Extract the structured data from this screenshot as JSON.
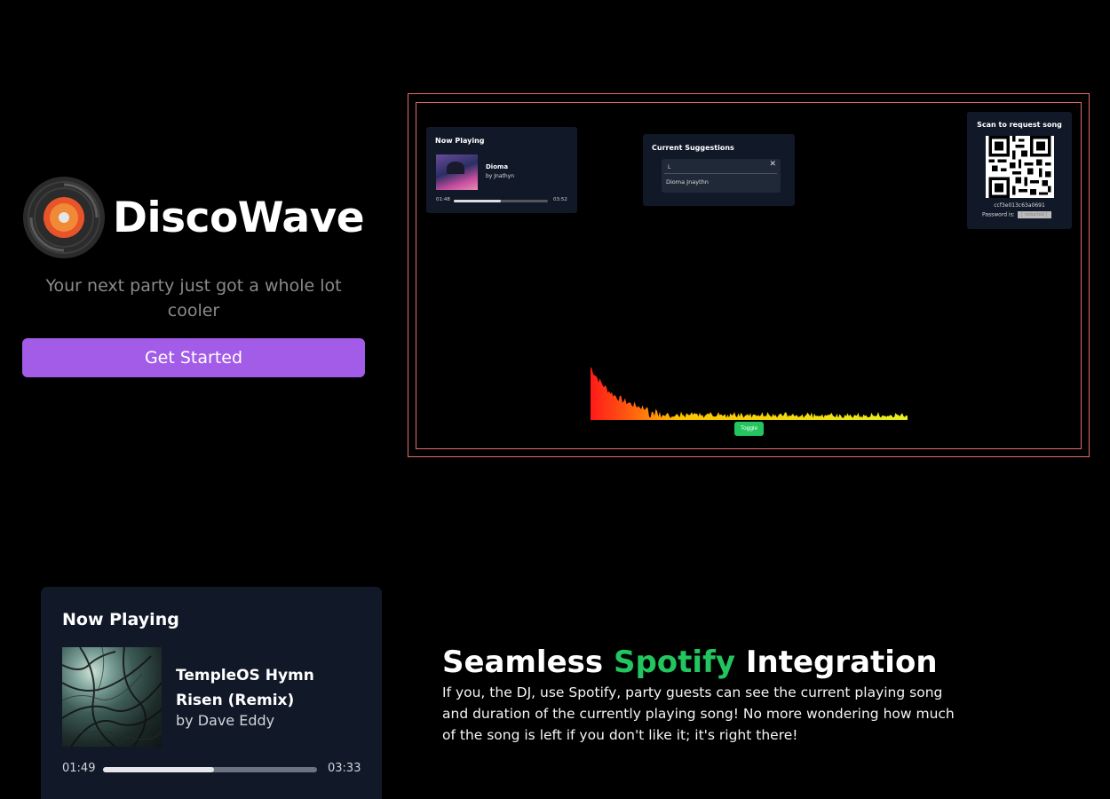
{
  "hero": {
    "brand_name": "DiscoWave",
    "tagline": "Your next party just got a whole lot cooler",
    "cta_label": "Get Started"
  },
  "preview": {
    "now_playing": {
      "title": "Now Playing",
      "song": "Dioma",
      "artist": "by Jnathyn",
      "elapsed": "01:48",
      "duration": "03:52",
      "progress": 0.5
    },
    "suggestions": {
      "title": "Current Suggestions",
      "input_value": "L",
      "result": "Dioma Jnaythn"
    },
    "qr": {
      "title": "Scan to request song",
      "session_id": "ccf3e013c63a0691",
      "password_label": "Password is:",
      "password_value": "[ redacted ]"
    },
    "toggle_label": "Toggle"
  },
  "now_playing": {
    "title": "Now Playing",
    "song": "TempleOS Hymn Risen (Remix)",
    "artist": "by Dave Eddy",
    "elapsed": "01:49",
    "duration": "03:33",
    "progress": 0.52
  },
  "feature": {
    "heading_pre": "Seamless ",
    "heading_accent": "Spotify",
    "heading_post": " Integration",
    "body": "If you, the DJ, use Spotify, party guests can see the current playing song and duration of the currently playing song! No more wondering how much of the song is left if you don't like it; it's right there!"
  },
  "colors": {
    "accent_purple": "#a35ce8",
    "spotify_green": "#22c55e",
    "card_bg": "#111827",
    "preview_border": "#e56a6a"
  }
}
